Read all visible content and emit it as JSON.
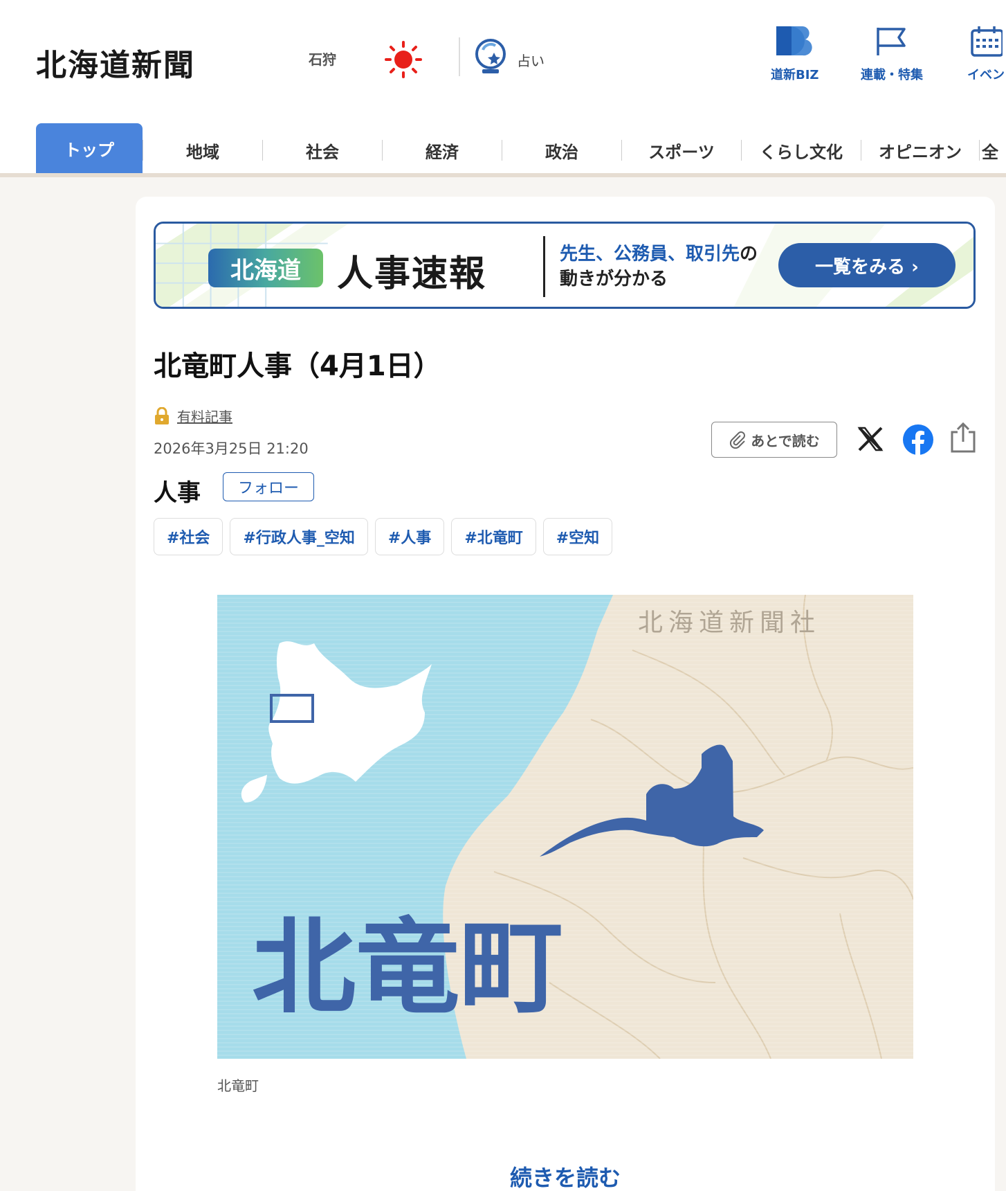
{
  "header": {
    "logo": "北海道新聞",
    "region": "石狩",
    "weather_icon": "sunny-icon",
    "fortune_label": "占い",
    "nav": [
      {
        "label": "道新BIZ",
        "icon": "biz-logo-icon"
      },
      {
        "label": "連載・特集",
        "icon": "flag-icon"
      },
      {
        "label": "イベン",
        "icon": "calendar-icon"
      }
    ]
  },
  "tabs": [
    "トップ",
    "地域",
    "社会",
    "経済",
    "政治",
    "スポーツ",
    "くらし文化",
    "オピニオン",
    "全"
  ],
  "banner": {
    "pill": "北海道",
    "title": "人事速報",
    "sub_blue": "先生、公務員、取引先",
    "sub_black1": "の",
    "sub_black2": "動きが分かる",
    "button": "一覧をみる ›"
  },
  "article": {
    "title": "北竜町人事（4月1日）",
    "paid_label": "有料記事",
    "date": "2026年3月25日 21:20",
    "read_later": "あとで読む",
    "category": "人事",
    "follow": "フォロー",
    "tags": [
      "#社会",
      "#行政人事_空知",
      "#人事",
      "#北竜町",
      "#空知"
    ],
    "map_town_label": "北竜町",
    "map_watermark": "北海道新聞社",
    "caption": "北竜町",
    "continue": "続きを読む"
  },
  "colors": {
    "brand_blue": "#1e5bb0",
    "tab_active": "#4a84dc",
    "sea": "#a6dcea",
    "land": "#efe6d6",
    "town": "#3f65a8"
  }
}
